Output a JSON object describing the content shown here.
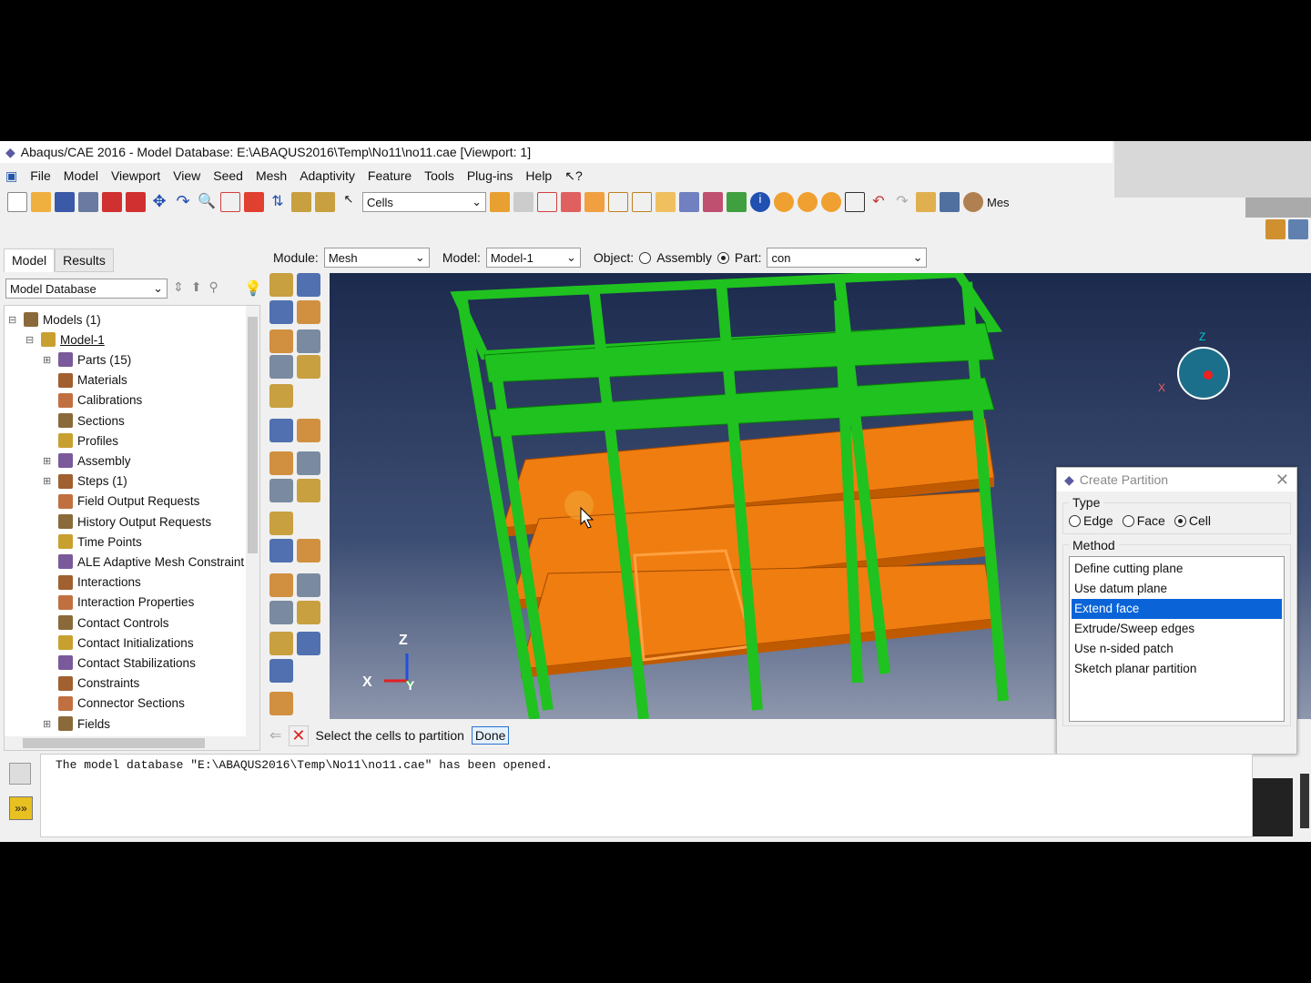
{
  "title": "Abaqus/CAE 2016 - Model Database: E:\\ABAQUS2016\\Temp\\No11\\no11.cae [Viewport: 1]",
  "menu": [
    "File",
    "Model",
    "Viewport",
    "View",
    "Seed",
    "Mesh",
    "Adaptivity",
    "Feature",
    "Tools",
    "Plug-ins",
    "Help",
    "↖?"
  ],
  "toolbar": {
    "selection_filter": "Cells",
    "truncated_label": "Mes"
  },
  "tabs": [
    "Model",
    "Results"
  ],
  "context": {
    "module_label": "Module:",
    "module": "Mesh",
    "model_label": "Model:",
    "model": "Model-1",
    "object_label": "Object:",
    "assembly": "Assembly",
    "part_label": "Part:",
    "part": "con",
    "object_selected": "Part"
  },
  "tree": {
    "root_select": "Model Database",
    "items": [
      {
        "label": "Models (1)",
        "level": 0,
        "exp": "-"
      },
      {
        "label": "Model-1",
        "level": 1,
        "exp": "-"
      },
      {
        "label": "Parts (15)",
        "level": 2,
        "exp": "+"
      },
      {
        "label": "Materials",
        "level": 2
      },
      {
        "label": "Calibrations",
        "level": 2
      },
      {
        "label": "Sections",
        "level": 2
      },
      {
        "label": "Profiles",
        "level": 2
      },
      {
        "label": "Assembly",
        "level": 2,
        "exp": "+"
      },
      {
        "label": "Steps (1)",
        "level": 2,
        "exp": "+"
      },
      {
        "label": "Field Output Requests",
        "level": 2
      },
      {
        "label": "History Output Requests",
        "level": 2
      },
      {
        "label": "Time Points",
        "level": 2
      },
      {
        "label": "ALE Adaptive Mesh Constraint",
        "level": 2
      },
      {
        "label": "Interactions",
        "level": 2
      },
      {
        "label": "Interaction Properties",
        "level": 2
      },
      {
        "label": "Contact Controls",
        "level": 2
      },
      {
        "label": "Contact Initializations",
        "level": 2
      },
      {
        "label": "Contact Stabilizations",
        "level": 2
      },
      {
        "label": "Constraints",
        "level": 2
      },
      {
        "label": "Connector Sections",
        "level": 2
      },
      {
        "label": "Fields",
        "level": 2,
        "exp": "+"
      }
    ]
  },
  "triad": {
    "x": "X",
    "y": "Y",
    "z": "Z"
  },
  "prompt": {
    "text": "Select the cells to partition",
    "done": "Done"
  },
  "message": "The model database \"E:\\ABAQUS2016\\Temp\\No11\\no11.cae\" has been opened.",
  "dialog": {
    "title": "Create Partition",
    "type_label": "Type",
    "types": [
      "Edge",
      "Face",
      "Cell"
    ],
    "type_selected": "Cell",
    "method_label": "Method",
    "methods": [
      "Define cutting plane",
      "Use datum plane",
      "Extend face",
      "Extrude/Sweep edges",
      "Use n-sided patch",
      "Sketch planar partition"
    ],
    "method_selected": "Extend face"
  },
  "colors": {
    "frame": "#1fc21f",
    "slab": "#f07d10",
    "highlight": "#0a64d8"
  }
}
